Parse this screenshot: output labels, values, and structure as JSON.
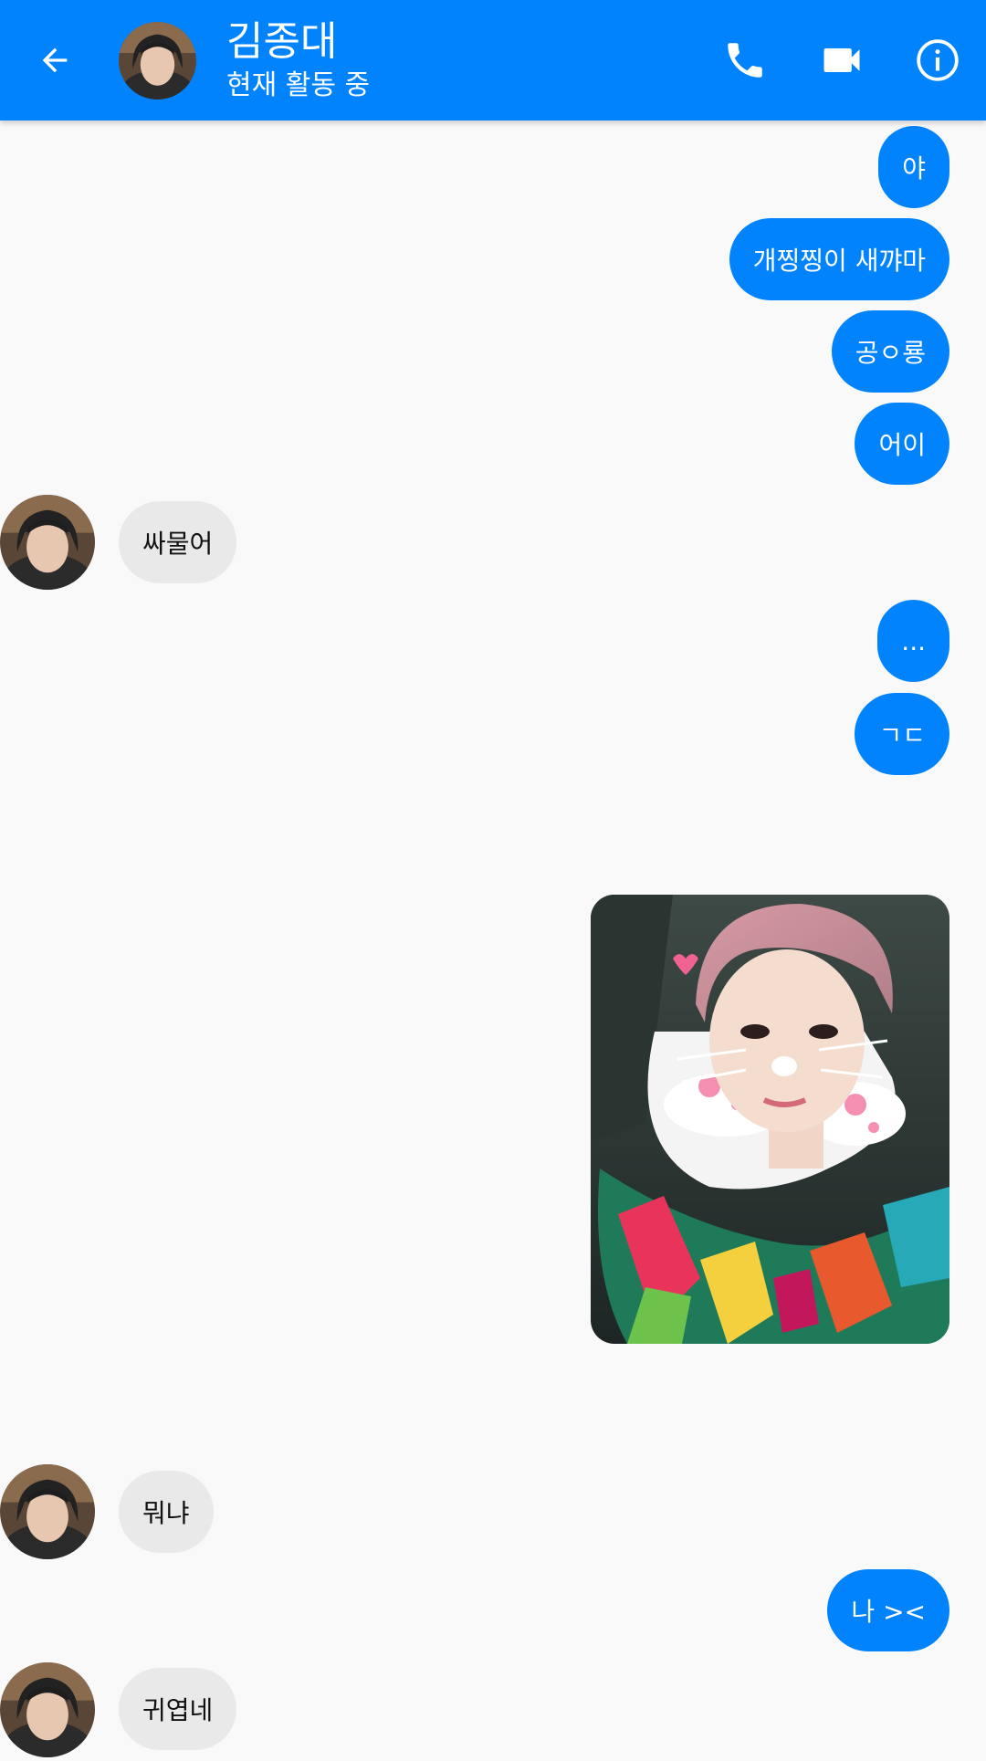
{
  "header": {
    "name": "김종대",
    "status": "현재 활동 중",
    "background_color": "#0183fe",
    "icons": {
      "back": "arrow-left-icon",
      "call": "phone-icon",
      "video": "video-camera-icon",
      "info": "info-circle-icon"
    }
  },
  "colors": {
    "outgoing_bubble": "#0183fe",
    "incoming_bubble": "#e9e9e9",
    "background": "#f9f9f9"
  },
  "messages": [
    {
      "from": "me",
      "text": "야"
    },
    {
      "from": "me",
      "text": "개찡찡이 새꺄마"
    },
    {
      "from": "me",
      "text": "공ㅇ룡"
    },
    {
      "from": "me",
      "text": "어이"
    },
    {
      "from": "them",
      "text": "싸물어"
    },
    {
      "from": "me",
      "text": "..."
    },
    {
      "from": "me",
      "text": "ㄱㄷ"
    },
    {
      "from": "me",
      "type": "photo"
    },
    {
      "from": "them",
      "text": "뭐냐"
    },
    {
      "from": "me",
      "text": "나 ><"
    },
    {
      "from": "them",
      "text": "귀엽네"
    }
  ]
}
